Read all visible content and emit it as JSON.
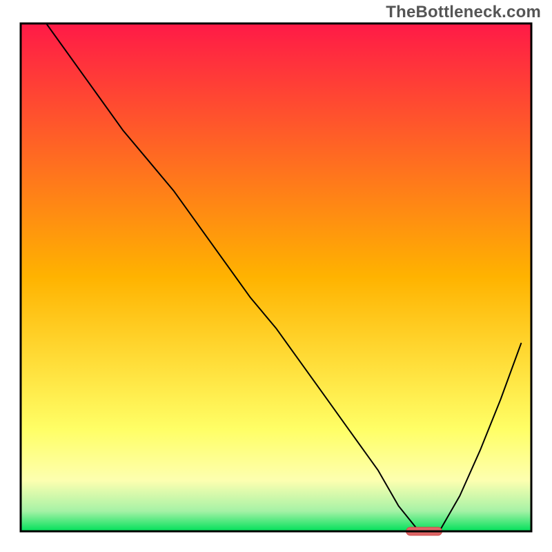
{
  "watermark": "TheBottleneck.com",
  "chart_data": {
    "type": "line",
    "title": "",
    "xlabel": "",
    "ylabel": "",
    "x_range": [
      0,
      100
    ],
    "y_range": [
      0,
      100
    ],
    "grid": false,
    "legend": false,
    "background_gradient": {
      "stops": [
        {
          "offset": 0.0,
          "color": "#ff1a47"
        },
        {
          "offset": 0.5,
          "color": "#ffb300"
        },
        {
          "offset": 0.8,
          "color": "#ffff66"
        },
        {
          "offset": 0.9,
          "color": "#fdffb0"
        },
        {
          "offset": 0.96,
          "color": "#a6f2a6"
        },
        {
          "offset": 1.0,
          "color": "#00e05a"
        }
      ]
    },
    "series": [
      {
        "name": "bottleneck-curve",
        "x": [
          5,
          10,
          15,
          20,
          25,
          30,
          35,
          40,
          45,
          50,
          55,
          60,
          65,
          70,
          74,
          78,
          80,
          82,
          86,
          90,
          94,
          98
        ],
        "y": [
          100,
          93,
          86,
          79,
          73,
          67,
          60,
          53,
          46,
          40,
          33,
          26,
          19,
          12,
          5,
          0,
          0,
          0,
          7,
          16,
          26,
          37
        ],
        "color": "#000000",
        "width": 2
      }
    ],
    "marker": {
      "name": "optimal-point-marker",
      "x_center": 79,
      "y_center": 0,
      "width_x": 7,
      "height_y": 1.6,
      "fill": "#e06666",
      "stroke": "#d04a4a"
    },
    "frame": {
      "stroke": "#000000",
      "width": 3
    }
  }
}
